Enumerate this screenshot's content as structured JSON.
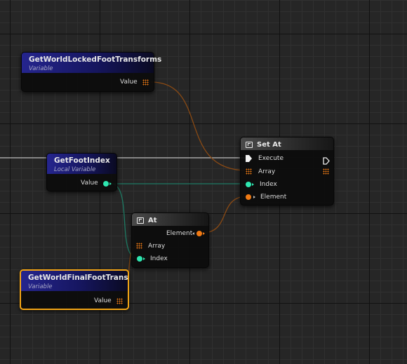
{
  "nodes": {
    "get_world_locked": {
      "title": "GetWorldLockedFootTransforms",
      "subtitle": "Variable",
      "value_label": "Value"
    },
    "get_foot_index": {
      "title": "GetFootIndex",
      "subtitle": "Local Variable",
      "value_label": "Value"
    },
    "set_at": {
      "title": "Set At",
      "execute_label": "Execute",
      "array_label": "Array",
      "index_label": "Index",
      "element_label": "Element"
    },
    "at": {
      "title": "At",
      "element_label": "Element",
      "array_label": "Array",
      "index_label": "Index"
    },
    "get_world_final": {
      "title": "GetWorldFinalFootTrans",
      "subtitle": "Variable",
      "value_label": "Value"
    }
  },
  "colors": {
    "array_pin": "#f07a14",
    "int_pin": "#2ee6b0",
    "variable_header": "#25258e",
    "selection": "#f3a515"
  }
}
